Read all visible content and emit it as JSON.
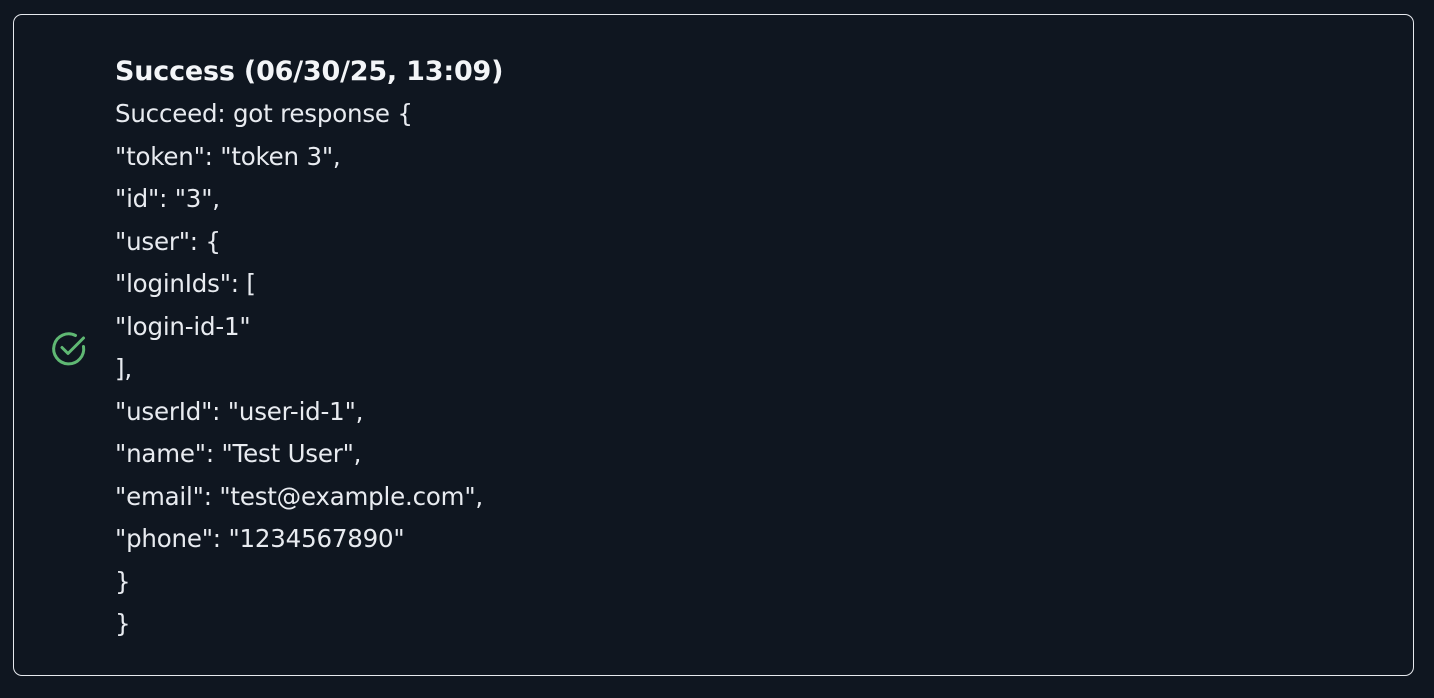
{
  "toast": {
    "status": "success",
    "icon": "check-circle-icon",
    "accent_color": "#5fb873",
    "border_color": "#e6e9ee",
    "background_color": "#0f1620",
    "title": "Success (06/30/25, 13:09)",
    "message_lines": [
      "Succeed: got response {",
      "\"token\": \"token 3\",",
      "\"id\": \"3\",",
      "\"user\": {",
      "\"loginIds\": [",
      "\"login-id-1\"",
      "],",
      "\"userId\": \"user-id-1\",",
      "\"name\": \"Test User\",",
      "\"email\": \"test@example.com\",",
      "\"phone\": \"1234567890\"",
      "}",
      "}"
    ]
  }
}
